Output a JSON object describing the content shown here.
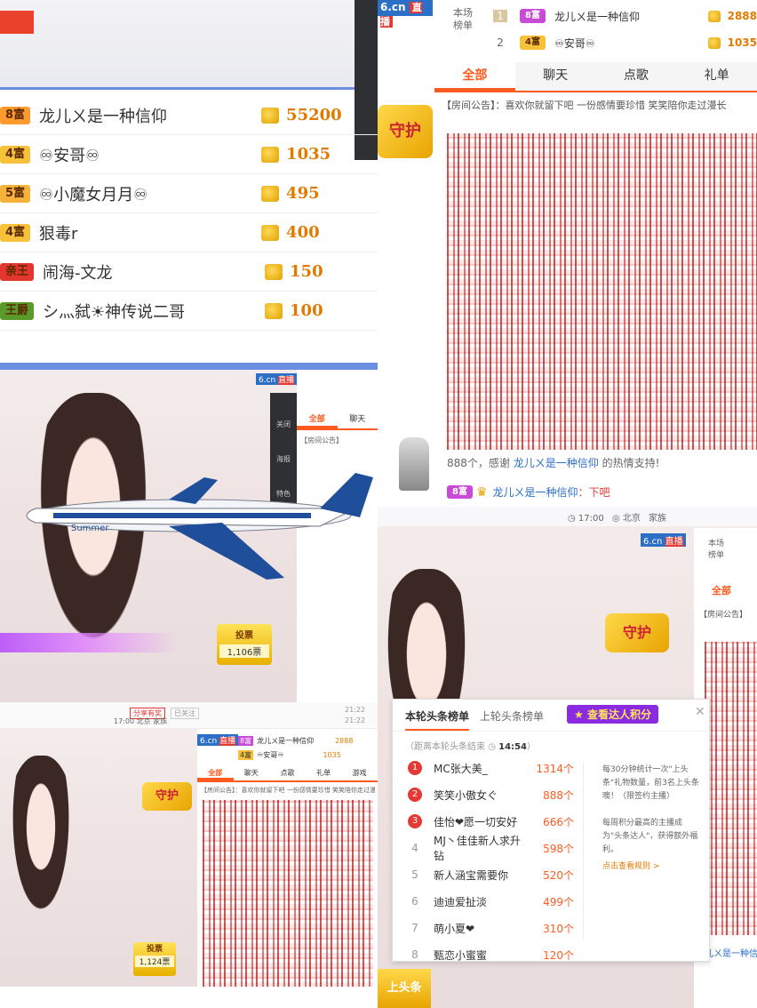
{
  "brand": {
    "site": "6.cn",
    "live": "直播"
  },
  "rank_tabs": {
    "label1": "本场",
    "label2": "榜单"
  },
  "top_ranks": [
    {
      "pos": "1",
      "badge": "8富",
      "name": "龙儿ㄨ是一种信仰",
      "score": "2888"
    },
    {
      "pos": "2",
      "badge": "4富",
      "name": "♾安哥♾",
      "score": "1035"
    }
  ],
  "big_rank_list": [
    {
      "badge": "8富",
      "badge_color": "#ff9a2e",
      "name": "龙儿ㄨ是一种信仰",
      "score": "55200"
    },
    {
      "badge": "4富",
      "badge_color": "#f7c23a",
      "name": "♾安哥♾",
      "score": "1035"
    },
    {
      "badge": "5富",
      "badge_color": "#f7b23a",
      "name": "♾小魔女月月♾",
      "score": "495"
    },
    {
      "badge": "4富",
      "badge_color": "#f7c23a",
      "name": "狠毒r",
      "score": "400"
    },
    {
      "badge": "亲王",
      "badge_color": "#e2362e",
      "name": "闹海-文龙",
      "score": "150"
    },
    {
      "badge": "王爵",
      "badge_color": "#5a9a2a",
      "name": "シ灬弑☀神传说二哥",
      "score": "100"
    }
  ],
  "chat_tabs": [
    "全部",
    "聊天",
    "点歌",
    "礼单"
  ],
  "chat_tabs_small": [
    "全部",
    "聊天",
    "点歌",
    "礼单",
    "游戏"
  ],
  "announcement": "【房间公告】：喜欢你就留下吧 一份感情要珍惜 笑笑陪你走过漫长",
  "announcement_short": "【房间公告】",
  "gift_msg": "888个，感谢",
  "gift_user": "龙儿ㄨ是一种信仰",
  "gift_suffix": "的热情支持!",
  "chat_line": {
    "badge": "8富",
    "name": "龙儿ㄨ是一种信仰",
    "text": "：下吧"
  },
  "status": {
    "time": "17:00",
    "city": "北京",
    "family": "家族"
  },
  "vote": {
    "label": "投票",
    "count1": "1,106票",
    "count2": "1,124票"
  },
  "side_icons": [
    "关闭",
    "海报",
    "特色"
  ],
  "plane_label": "Summer",
  "guard_label": "守护",
  "share": {
    "share": "分享有奖",
    "follow": "已关注",
    "time1": "21:22",
    "time2": "21:22"
  },
  "leaderboard": {
    "tab_current": "本轮头条榜单",
    "tab_prev": "上轮头条榜单",
    "btn": "查看达人积分",
    "countdown_label": "距离本轮头条结束",
    "countdown": "14:54",
    "rows": [
      {
        "num": "1",
        "name": "MC张大美_",
        "score": "1314个"
      },
      {
        "num": "2",
        "name": "笑笑小傲女ぐ",
        "score": "888个"
      },
      {
        "num": "3",
        "name": "佳怡❤愿一切安好",
        "score": "666个"
      },
      {
        "num": "4",
        "name": "MJ丶佳佳新人求升钻",
        "score": "598个"
      },
      {
        "num": "5",
        "name": "新人涵宝需要你",
        "score": "520个"
      },
      {
        "num": "6",
        "name": "迪迪爱扯淡",
        "score": "499个"
      },
      {
        "num": "7",
        "name": "萌小夏❤",
        "score": "310个"
      },
      {
        "num": "8",
        "name": "甄恋小蜜蜜",
        "score": "120个"
      }
    ],
    "note1": "每30分钟统计一次\"上头条\"礼物数量，前3名上头条噢！（限签约主播）",
    "note2": "每周积分最高的主播成为\"头条达人\"，获得额外福利。",
    "rules_link": "点击查看规则 >"
  },
  "headline_badge": "上头条",
  "colors": {
    "accent": "#ff5a1f",
    "coin": "#e0a100"
  }
}
